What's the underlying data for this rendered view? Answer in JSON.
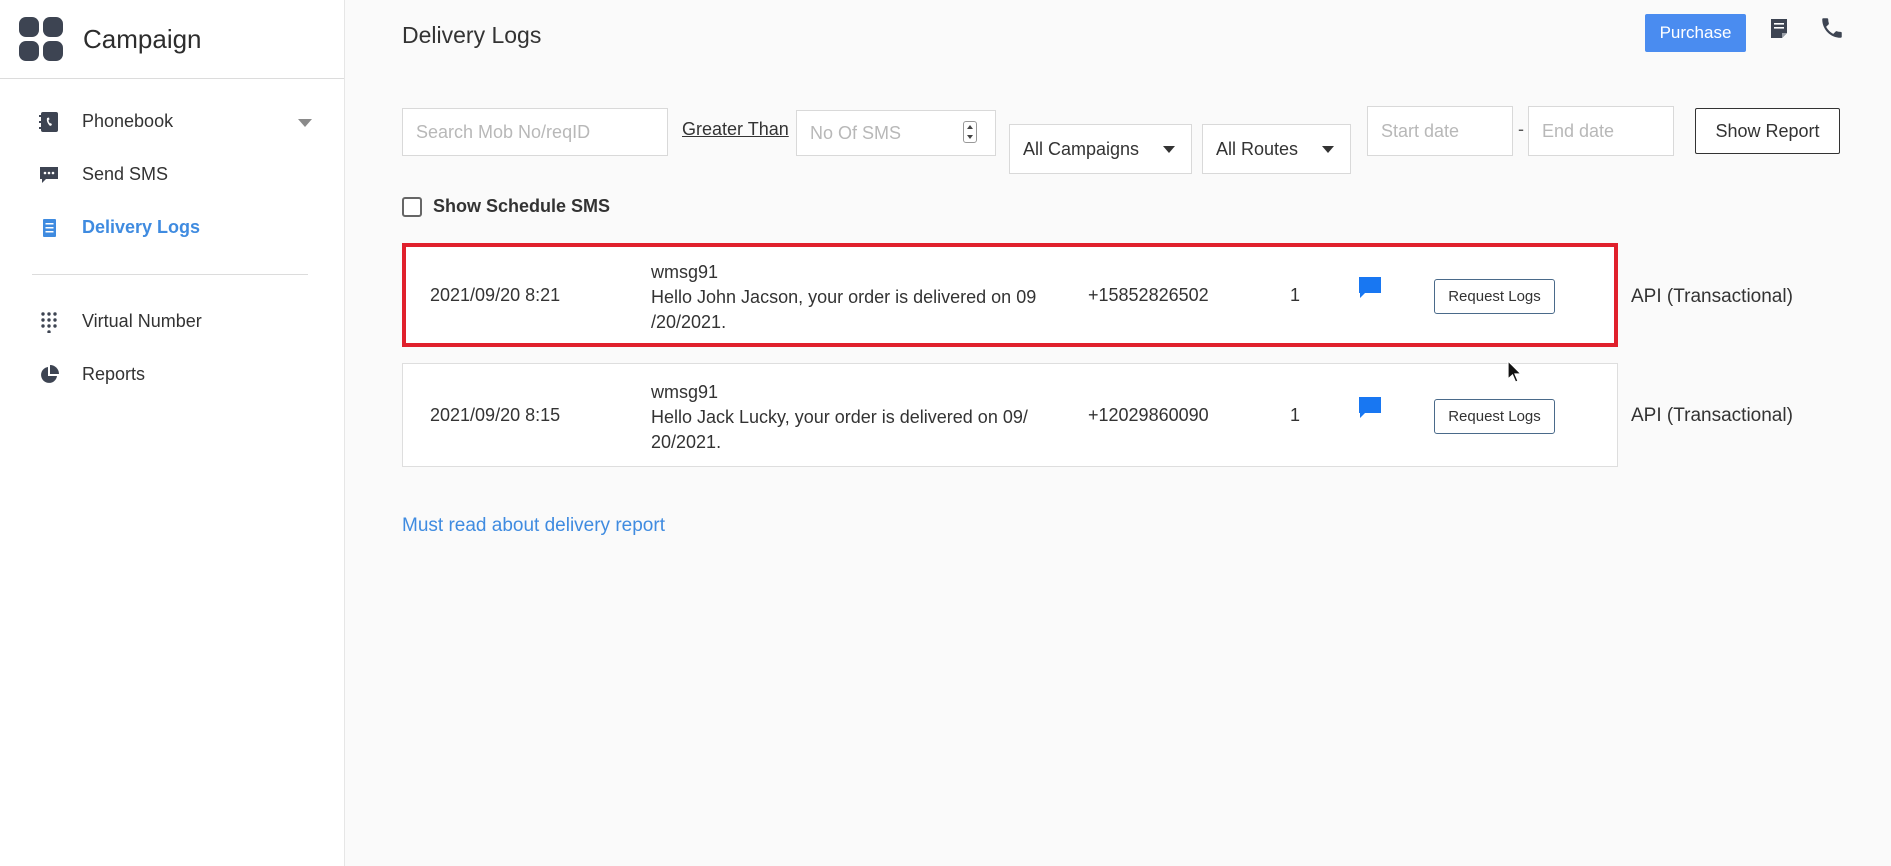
{
  "sidebar": {
    "brand": "Campaign",
    "items": [
      {
        "label": "Phonebook"
      },
      {
        "label": "Send SMS"
      },
      {
        "label": "Delivery Logs"
      },
      {
        "label": "Virtual Number"
      },
      {
        "label": "Reports"
      }
    ]
  },
  "header": {
    "title": "Delivery Logs",
    "purchase_label": "Purchase",
    "icons": [
      "notes-icon",
      "phone-icon"
    ]
  },
  "filters": {
    "search_placeholder": "Search Mob No/reqID",
    "greater_than": "Greater Than",
    "sms_count_placeholder": "No Of SMS",
    "campaign_selected": "All Campaigns",
    "route_selected": "All Routes",
    "start_date_placeholder": "Start date",
    "date_separator": "-",
    "end_date_placeholder": "End date",
    "show_report_label": "Show Report",
    "schedule_label": "Show Schedule SMS"
  },
  "logs": [
    {
      "datetime": "2021/09/20 8:21",
      "sender": "wmsg91",
      "message_line1": "Hello John Jacson, your order is delivered on 09",
      "message_line2": "/20/2021.",
      "phone": "+15852826502",
      "count": "1",
      "request_label": "Request Logs",
      "route": "API (Transactional)"
    },
    {
      "datetime": "2021/09/20 8:15",
      "sender": "wmsg91",
      "message_line1": "Hello Jack Lucky, your order is delivered on 09/",
      "message_line2": "20/2021.",
      "phone": "+12029860090",
      "count": "1",
      "request_label": "Request Logs",
      "route": "API (Transactional)"
    }
  ],
  "footer_link": "Must read about delivery report",
  "colors": {
    "accent": "#3f8be0",
    "purchase": "#4a8cf0",
    "highlight": "#e0202c",
    "chat_icon": "#1877f2"
  }
}
